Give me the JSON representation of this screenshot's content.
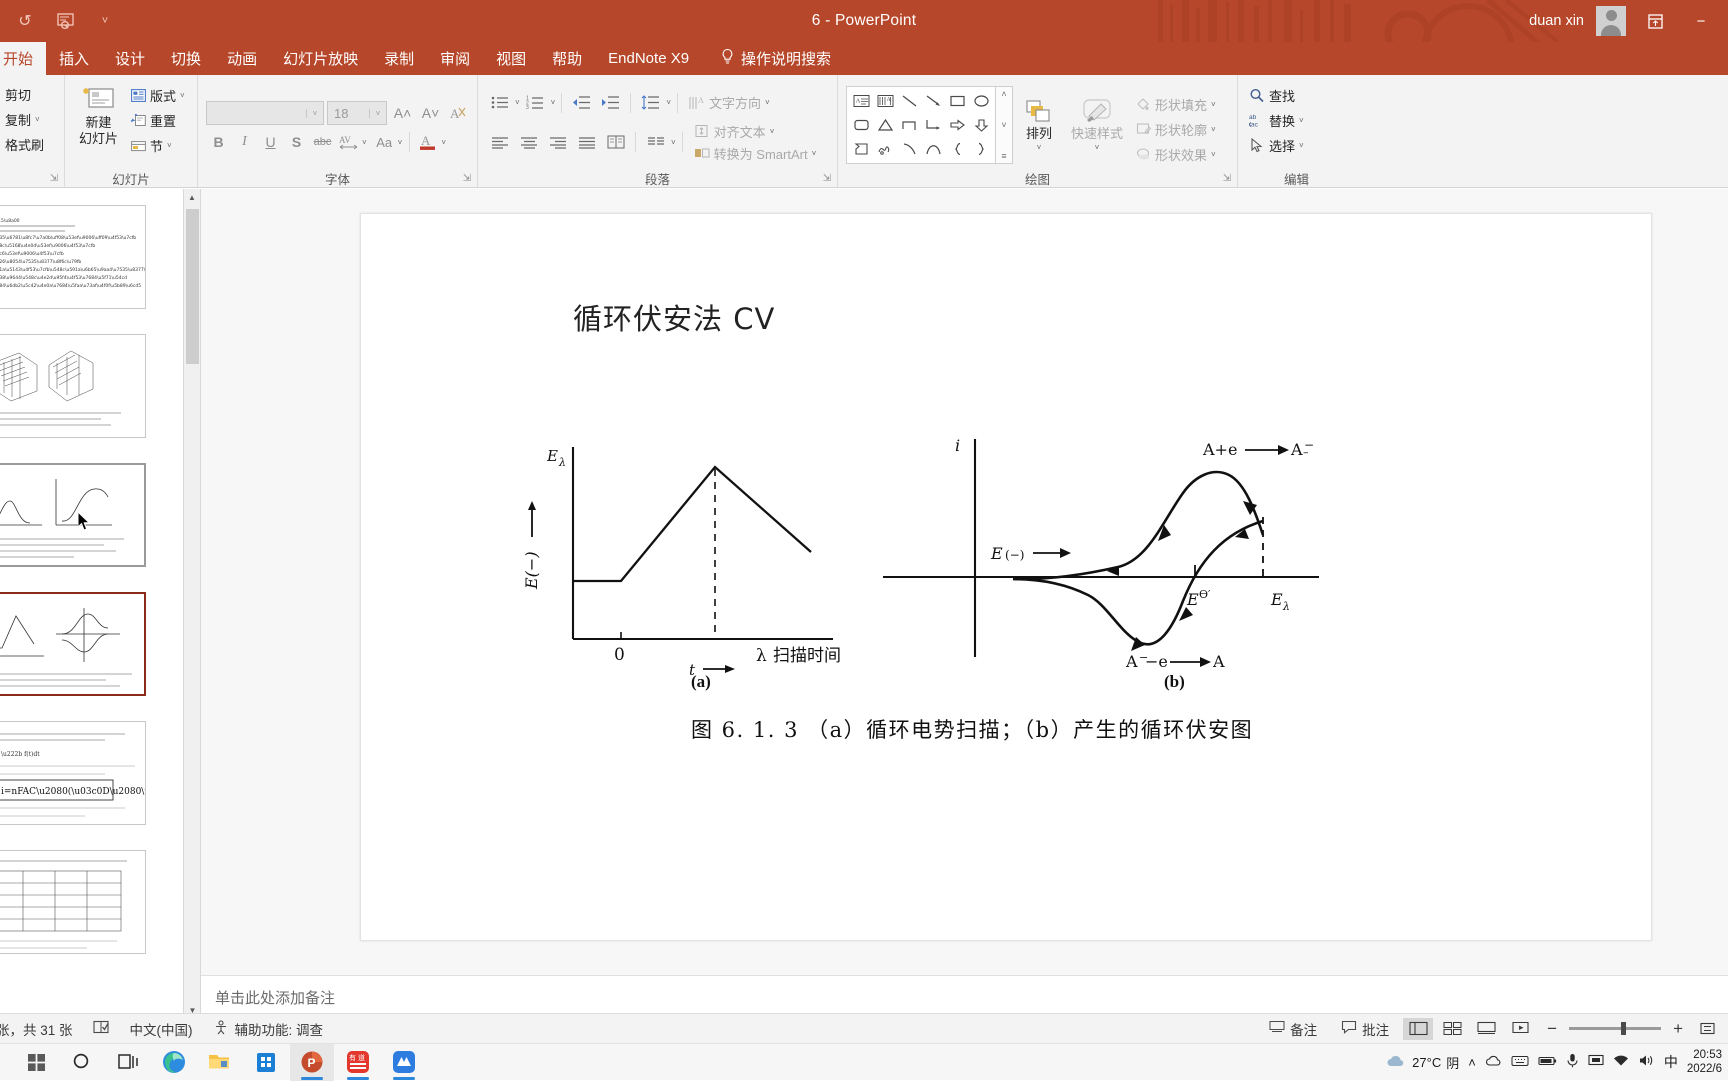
{
  "titlebar": {
    "quick_access": [
      {
        "name": "autosave-toggle",
        "glyph": "↺"
      },
      {
        "name": "present-icon",
        "glyph": "⊞"
      },
      {
        "name": "customize-qat-icon",
        "glyph": "˅"
      }
    ],
    "doc_title": "6  -  PowerPoint",
    "user_name": "duan xin",
    "ribbon_display_glyph": "⬒",
    "minimize_glyph": "−"
  },
  "tabs": [
    {
      "label": "开始",
      "active": true
    },
    {
      "label": "插入",
      "active": false
    },
    {
      "label": "设计",
      "active": false
    },
    {
      "label": "切换",
      "active": false
    },
    {
      "label": "动画",
      "active": false
    },
    {
      "label": "幻灯片放映",
      "active": false
    },
    {
      "label": "录制",
      "active": false
    },
    {
      "label": "审阅",
      "active": false
    },
    {
      "label": "视图",
      "active": false
    },
    {
      "label": "帮助",
      "active": false
    },
    {
      "label": "EndNote X9",
      "active": false
    }
  ],
  "tell_me": {
    "label": "操作说明搜索",
    "icon": "lightbulb-icon"
  },
  "ribbon": {
    "clipboard": {
      "label": "",
      "items": [
        {
          "label": "剪切",
          "icon": "scissors-icon"
        },
        {
          "label": "复制",
          "icon": "copy-icon",
          "caret": true
        },
        {
          "label": "格式刷",
          "icon": "format-painter-icon"
        }
      ]
    },
    "slides": {
      "label": "幻灯片",
      "new_slide": {
        "line1": "新建",
        "line2": "幻灯片",
        "icon": "new-slide-icon"
      },
      "items": [
        {
          "label": "版式",
          "icon": "layout-icon",
          "caret": true
        },
        {
          "label": "重置",
          "icon": "reset-icon",
          "caret": false
        },
        {
          "label": "节",
          "icon": "section-icon",
          "caret": true
        }
      ]
    },
    "font": {
      "label": "字体",
      "font_name": "",
      "font_name_placeholder": "",
      "font_size": "18",
      "buttons": [
        {
          "name": "grow-font-button",
          "glyph": "A˄"
        },
        {
          "name": "shrink-font-button",
          "glyph": "A˅"
        },
        {
          "name": "clear-formatting-button",
          "glyph": "A⌀"
        },
        {
          "name": "bold-button",
          "glyph": "B"
        },
        {
          "name": "italic-button",
          "glyph": "I"
        },
        {
          "name": "underline-button",
          "glyph": "U"
        },
        {
          "name": "shadow-button",
          "glyph": "S"
        },
        {
          "name": "strikethrough-button",
          "glyph": "abc"
        },
        {
          "name": "character-spacing-button",
          "glyph": "AV"
        },
        {
          "name": "change-case-button",
          "glyph": "Aa"
        },
        {
          "name": "font-color-button",
          "glyph": "A"
        }
      ]
    },
    "paragraph": {
      "label": "段落",
      "items": [
        {
          "label": "文字方向",
          "icon": "text-direction-icon",
          "caret": true
        },
        {
          "label": "对齐文本",
          "icon": "align-text-icon",
          "caret": true
        },
        {
          "label": "转换为 SmartArt",
          "icon": "smartart-icon",
          "caret": true
        }
      ]
    },
    "drawing": {
      "label": "绘图",
      "shapes": [
        "textbox-icon",
        "vertical-textbox-icon",
        "line-icon",
        "arrow-icon",
        "rectangle-icon",
        "oval-icon",
        "rounded-rect-icon",
        "triangle-icon",
        "elbow-connector-icon",
        "elbow-arrow-connector-icon",
        "right-arrow-icon",
        "down-arrow-icon",
        "flowchart-icon",
        "freeform-scribble-icon",
        "curve-icon",
        "arc-icon",
        "left-brace-icon",
        "right-brace-icon"
      ],
      "arrange": {
        "label": "排列",
        "icon": "arrange-icon",
        "caret": true
      },
      "quick_styles": {
        "label": "快速样式",
        "icon": "quick-styles-icon",
        "caret": true
      },
      "items": [
        {
          "label": "形状填充",
          "icon": "shape-fill-icon",
          "caret": true
        },
        {
          "label": "形状轮廓",
          "icon": "shape-outline-icon",
          "caret": true
        },
        {
          "label": "形状效果",
          "icon": "shape-effects-icon",
          "caret": true
        }
      ]
    },
    "editing": {
      "label": "编辑",
      "items": [
        {
          "label": "查找",
          "icon": "search-icon",
          "caret": false
        },
        {
          "label": "替换",
          "icon": "replace-icon",
          "caret": true
        },
        {
          "label": "选择",
          "icon": "select-pointer-icon",
          "caret": true
        }
      ]
    }
  },
  "slide": {
    "title": "循环伏安法  CV",
    "fig_a_label": "(a)",
    "fig_b_label": "(b)",
    "caption": "图 6. 1. 3  （a）循环电势扫描；（b）产生的循环伏安图"
  },
  "chart_data": [
    {
      "type": "line",
      "name": "cyclic-potential-sweep",
      "title": "(a) 循环电势扫描",
      "xlabel": "t",
      "ylabel": "E(−)",
      "x_axis_end_label": "λ 扫描时间",
      "y_axis_top_label": "Eλ",
      "x_origin_tick_label": "0",
      "grid": false,
      "legend": "none",
      "series": [
        {
          "name": "potential-waveform",
          "points": [
            [
              0.0,
              0.2
            ],
            [
              0.22,
              0.2
            ],
            [
              0.62,
              0.92
            ],
            [
              1.0,
              0.52
            ]
          ]
        }
      ],
      "annotations": [
        {
          "text": "Eλ",
          "at": [
            0.62,
            0.92
          ],
          "kind": "peak-dashed-line"
        }
      ]
    },
    {
      "type": "line",
      "name": "cyclic-voltammogram",
      "title": "(b) 产生的循环伏安图",
      "xlabel": "E(−)",
      "ylabel": "i",
      "grid": false,
      "legend": "none",
      "tick_labels": [
        "EΘ′",
        "Eλ"
      ],
      "annotations": [
        {
          "text": "A+e ⟶ Ā⁻",
          "position": "upper-right"
        },
        {
          "text": "Ā⁻−e ⟶ A",
          "position": "lower-right"
        },
        {
          "text": "EΘ′",
          "position": "x-axis-tick"
        },
        {
          "text": "Eλ",
          "position": "x-axis-right-dashed"
        }
      ],
      "series": [
        {
          "name": "forward-cathodic-scan",
          "direction": "left-to-right-peak"
        },
        {
          "name": "reverse-anodic-scan",
          "direction": "right-to-left-trough"
        }
      ]
    }
  ],
  "notes": {
    "placeholder": "单击此处添加备注"
  },
  "statusbar": {
    "slide_count": "张，共 31 张",
    "spellcheck_icon": "spellcheck-icon",
    "language": "中文(中国)",
    "accessibility": "辅助功能: 调查",
    "notes_button": "备注",
    "comments_button": "批注",
    "views": [
      "normal-view",
      "slide-sorter-view",
      "reading-view",
      "slideshow-view"
    ],
    "zoom_out": "−",
    "zoom_in": "+",
    "fit_icon": "fit-slide-icon"
  },
  "taskbar": {
    "apps": [
      {
        "name": "start-icon",
        "glyph": ""
      },
      {
        "name": "search-icon",
        "glyph": "○"
      },
      {
        "name": "task-view-icon",
        "glyph": "⌸"
      },
      {
        "name": "edge-icon",
        "glyph": ""
      },
      {
        "name": "file-explorer-icon",
        "glyph": ""
      },
      {
        "name": "microsoft-store-icon",
        "glyph": ""
      },
      {
        "name": "powerpoint-icon",
        "glyph": "P"
      },
      {
        "name": "youdao-dictionary-icon",
        "glyph": "有道"
      },
      {
        "name": "app-blue-icon",
        "glyph": "M"
      }
    ],
    "weather_temp": "27°C",
    "weather_desc": "阴",
    "tray": [
      "˄",
      "☁",
      "⌨",
      "■",
      "🎤",
      "▣",
      "📶",
      "🔊",
      "中"
    ],
    "clock_time": "20:53",
    "clock_date": "2022/6"
  }
}
